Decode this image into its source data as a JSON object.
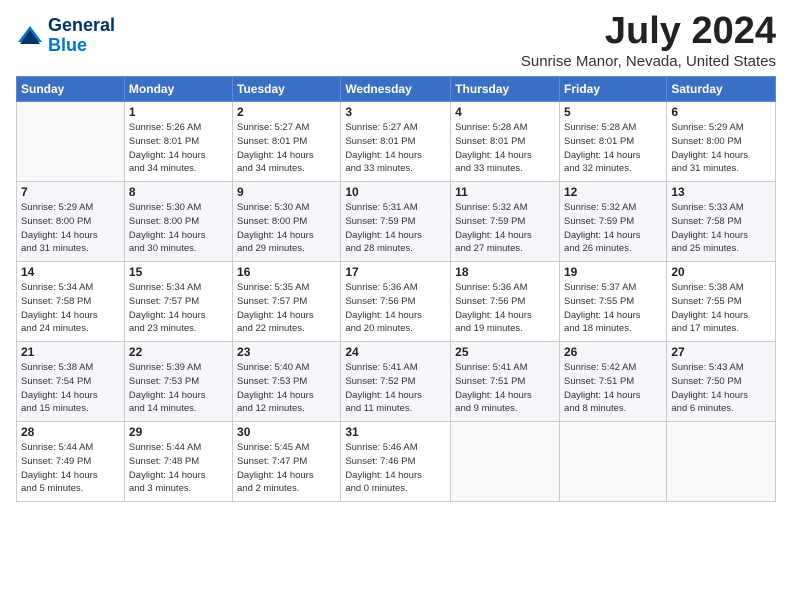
{
  "header": {
    "logo_line1": "General",
    "logo_line2": "Blue",
    "month_title": "July 2024",
    "location": "Sunrise Manor, Nevada, United States"
  },
  "weekdays": [
    "Sunday",
    "Monday",
    "Tuesday",
    "Wednesday",
    "Thursday",
    "Friday",
    "Saturday"
  ],
  "weeks": [
    [
      {
        "day": "",
        "info": ""
      },
      {
        "day": "1",
        "info": "Sunrise: 5:26 AM\nSunset: 8:01 PM\nDaylight: 14 hours\nand 34 minutes."
      },
      {
        "day": "2",
        "info": "Sunrise: 5:27 AM\nSunset: 8:01 PM\nDaylight: 14 hours\nand 34 minutes."
      },
      {
        "day": "3",
        "info": "Sunrise: 5:27 AM\nSunset: 8:01 PM\nDaylight: 14 hours\nand 33 minutes."
      },
      {
        "day": "4",
        "info": "Sunrise: 5:28 AM\nSunset: 8:01 PM\nDaylight: 14 hours\nand 33 minutes."
      },
      {
        "day": "5",
        "info": "Sunrise: 5:28 AM\nSunset: 8:01 PM\nDaylight: 14 hours\nand 32 minutes."
      },
      {
        "day": "6",
        "info": "Sunrise: 5:29 AM\nSunset: 8:00 PM\nDaylight: 14 hours\nand 31 minutes."
      }
    ],
    [
      {
        "day": "7",
        "info": "Sunrise: 5:29 AM\nSunset: 8:00 PM\nDaylight: 14 hours\nand 31 minutes."
      },
      {
        "day": "8",
        "info": "Sunrise: 5:30 AM\nSunset: 8:00 PM\nDaylight: 14 hours\nand 30 minutes."
      },
      {
        "day": "9",
        "info": "Sunrise: 5:30 AM\nSunset: 8:00 PM\nDaylight: 14 hours\nand 29 minutes."
      },
      {
        "day": "10",
        "info": "Sunrise: 5:31 AM\nSunset: 7:59 PM\nDaylight: 14 hours\nand 28 minutes."
      },
      {
        "day": "11",
        "info": "Sunrise: 5:32 AM\nSunset: 7:59 PM\nDaylight: 14 hours\nand 27 minutes."
      },
      {
        "day": "12",
        "info": "Sunrise: 5:32 AM\nSunset: 7:59 PM\nDaylight: 14 hours\nand 26 minutes."
      },
      {
        "day": "13",
        "info": "Sunrise: 5:33 AM\nSunset: 7:58 PM\nDaylight: 14 hours\nand 25 minutes."
      }
    ],
    [
      {
        "day": "14",
        "info": "Sunrise: 5:34 AM\nSunset: 7:58 PM\nDaylight: 14 hours\nand 24 minutes."
      },
      {
        "day": "15",
        "info": "Sunrise: 5:34 AM\nSunset: 7:57 PM\nDaylight: 14 hours\nand 23 minutes."
      },
      {
        "day": "16",
        "info": "Sunrise: 5:35 AM\nSunset: 7:57 PM\nDaylight: 14 hours\nand 22 minutes."
      },
      {
        "day": "17",
        "info": "Sunrise: 5:36 AM\nSunset: 7:56 PM\nDaylight: 14 hours\nand 20 minutes."
      },
      {
        "day": "18",
        "info": "Sunrise: 5:36 AM\nSunset: 7:56 PM\nDaylight: 14 hours\nand 19 minutes."
      },
      {
        "day": "19",
        "info": "Sunrise: 5:37 AM\nSunset: 7:55 PM\nDaylight: 14 hours\nand 18 minutes."
      },
      {
        "day": "20",
        "info": "Sunrise: 5:38 AM\nSunset: 7:55 PM\nDaylight: 14 hours\nand 17 minutes."
      }
    ],
    [
      {
        "day": "21",
        "info": "Sunrise: 5:38 AM\nSunset: 7:54 PM\nDaylight: 14 hours\nand 15 minutes."
      },
      {
        "day": "22",
        "info": "Sunrise: 5:39 AM\nSunset: 7:53 PM\nDaylight: 14 hours\nand 14 minutes."
      },
      {
        "day": "23",
        "info": "Sunrise: 5:40 AM\nSunset: 7:53 PM\nDaylight: 14 hours\nand 12 minutes."
      },
      {
        "day": "24",
        "info": "Sunrise: 5:41 AM\nSunset: 7:52 PM\nDaylight: 14 hours\nand 11 minutes."
      },
      {
        "day": "25",
        "info": "Sunrise: 5:41 AM\nSunset: 7:51 PM\nDaylight: 14 hours\nand 9 minutes."
      },
      {
        "day": "26",
        "info": "Sunrise: 5:42 AM\nSunset: 7:51 PM\nDaylight: 14 hours\nand 8 minutes."
      },
      {
        "day": "27",
        "info": "Sunrise: 5:43 AM\nSunset: 7:50 PM\nDaylight: 14 hours\nand 6 minutes."
      }
    ],
    [
      {
        "day": "28",
        "info": "Sunrise: 5:44 AM\nSunset: 7:49 PM\nDaylight: 14 hours\nand 5 minutes."
      },
      {
        "day": "29",
        "info": "Sunrise: 5:44 AM\nSunset: 7:48 PM\nDaylight: 14 hours\nand 3 minutes."
      },
      {
        "day": "30",
        "info": "Sunrise: 5:45 AM\nSunset: 7:47 PM\nDaylight: 14 hours\nand 2 minutes."
      },
      {
        "day": "31",
        "info": "Sunrise: 5:46 AM\nSunset: 7:46 PM\nDaylight: 14 hours\nand 0 minutes."
      },
      {
        "day": "",
        "info": ""
      },
      {
        "day": "",
        "info": ""
      },
      {
        "day": "",
        "info": ""
      }
    ]
  ]
}
